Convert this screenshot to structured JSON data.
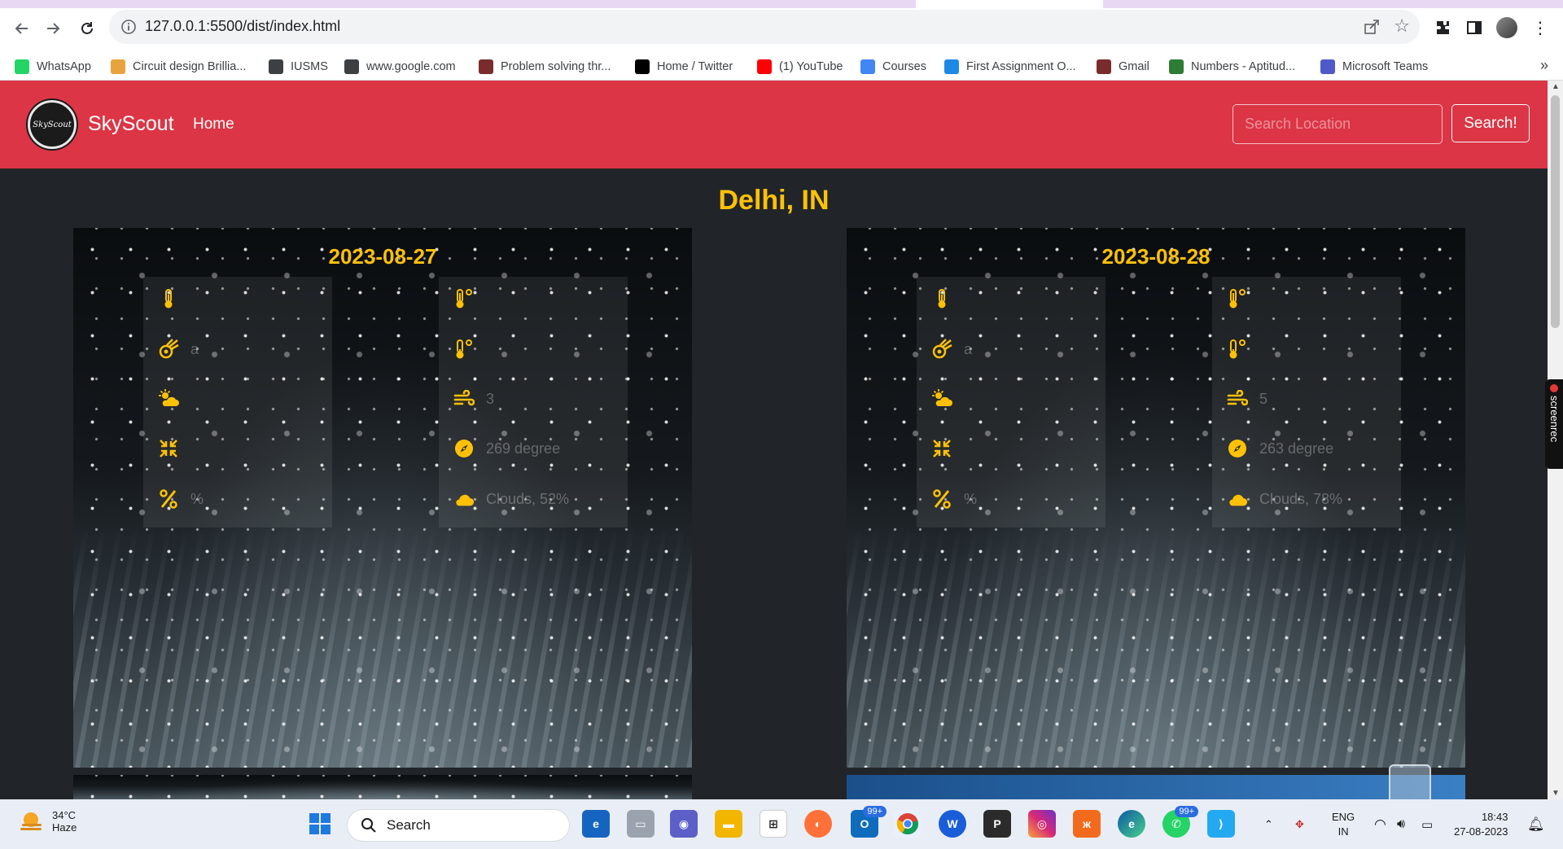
{
  "browser": {
    "url": "127.0.0.1:5500/dist/index.html",
    "bookmarks": [
      {
        "label": "WhatsApp",
        "icon": "whatsapp-icon",
        "color": "#25d366"
      },
      {
        "label": "Circuit design Brillia...",
        "icon": "brilliant-icon",
        "color": "#e8a33d"
      },
      {
        "label": "IUSMS",
        "icon": "globe-icon",
        "color": "#3c4043"
      },
      {
        "label": "www.google.com",
        "icon": "globe-icon",
        "color": "#3c4043"
      },
      {
        "label": "Problem solving thr...",
        "icon": "nptel-icon",
        "color": "#7a2c2c"
      },
      {
        "label": "Home / Twitter",
        "icon": "x-icon",
        "color": "#000000"
      },
      {
        "label": "(1) YouTube",
        "icon": "youtube-icon",
        "color": "#ff0000"
      },
      {
        "label": "Courses",
        "icon": "google-icon",
        "color": "#4285f4"
      },
      {
        "label": "First Assignment O...",
        "icon": "classroom-icon",
        "color": "#1e88e5"
      },
      {
        "label": "Gmail",
        "icon": "nptel-icon",
        "color": "#7a2c2c"
      },
      {
        "label": "Numbers - Aptitud...",
        "icon": "leaf-icon",
        "color": "#2e7d32"
      },
      {
        "label": "Microsoft Teams",
        "icon": "teams-icon",
        "color": "#5059c9"
      }
    ],
    "more": "»"
  },
  "app": {
    "brand": "SkyScout",
    "logo_text": "SkyScout",
    "nav_home": "Home",
    "search_placeholder": "Search Location",
    "search_button": "Search!",
    "location": "Delhi, IN"
  },
  "forecast": [
    {
      "date": "2023-08-27",
      "left": [
        {
          "icon": "thermometer-icon",
          "value": ""
        },
        {
          "icon": "meteor-icon",
          "value": "a"
        },
        {
          "icon": "cloud-sun-icon",
          "value": ""
        },
        {
          "icon": "compress-icon",
          "value": ""
        },
        {
          "icon": "percent-icon",
          "value": "%"
        }
      ],
      "right": [
        {
          "icon": "temperature-high-icon",
          "value": ""
        },
        {
          "icon": "temperature-low-icon",
          "value": ""
        },
        {
          "icon": "wind-icon",
          "value": "3"
        },
        {
          "icon": "compass-icon",
          "value": "269 degree"
        },
        {
          "icon": "cloud-icon",
          "value": "Clouds, 52%"
        }
      ]
    },
    {
      "date": "2023-08-28",
      "left": [
        {
          "icon": "thermometer-icon",
          "value": ""
        },
        {
          "icon": "meteor-icon",
          "value": "a"
        },
        {
          "icon": "cloud-sun-icon",
          "value": ""
        },
        {
          "icon": "compress-icon",
          "value": ""
        },
        {
          "icon": "percent-icon",
          "value": "%"
        }
      ],
      "right": [
        {
          "icon": "temperature-high-icon",
          "value": ""
        },
        {
          "icon": "temperature-low-icon",
          "value": ""
        },
        {
          "icon": "wind-icon",
          "value": "5"
        },
        {
          "icon": "compass-icon",
          "value": "263 degree"
        },
        {
          "icon": "cloud-icon",
          "value": "Clouds, 78%"
        }
      ]
    }
  ],
  "side_tab": "screenrec",
  "taskbar": {
    "weather_temp": "34°C",
    "weather_desc": "Haze",
    "search": "Search",
    "badge_outlook": "99+",
    "badge_whatsapp": "99+",
    "lang_top": "ENG",
    "lang_bottom": "IN",
    "time": "18:43",
    "date": "27-08-2023"
  }
}
